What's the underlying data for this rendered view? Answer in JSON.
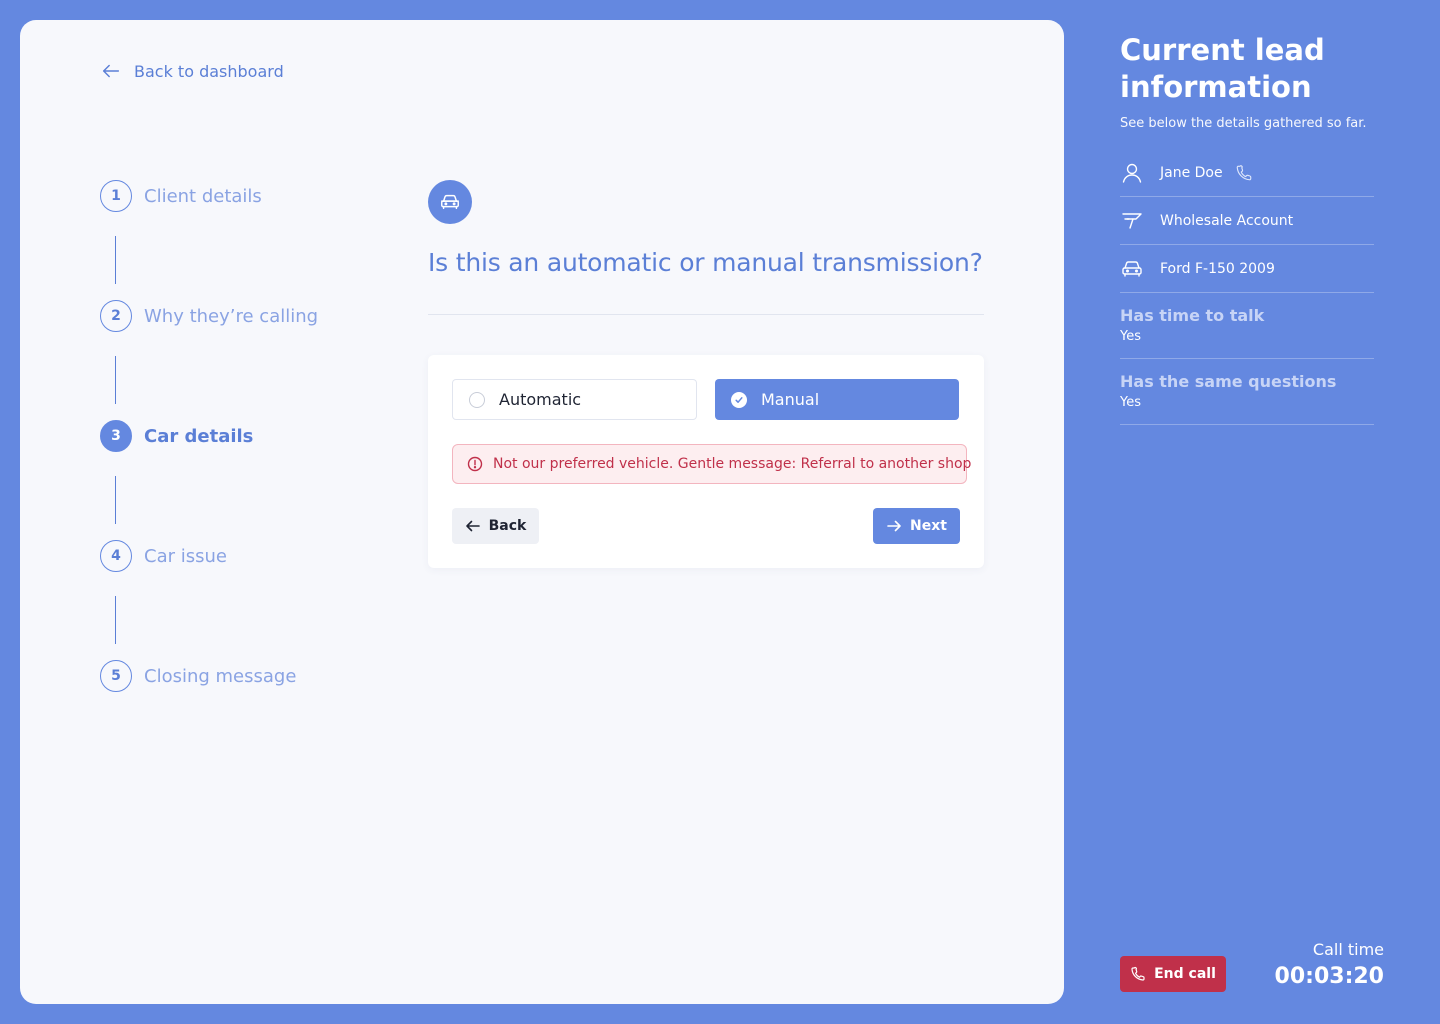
{
  "nav": {
    "back_label": "Back to dashboard"
  },
  "steps": [
    {
      "number": "1",
      "label": "Client details",
      "active": false
    },
    {
      "number": "2",
      "label": "Why they’re calling",
      "active": false
    },
    {
      "number": "3",
      "label": "Car details",
      "active": true
    },
    {
      "number": "4",
      "label": "Car issue",
      "active": false
    },
    {
      "number": "5",
      "label": "Closing message",
      "active": false
    }
  ],
  "question": {
    "icon": "car-icon",
    "text": "Is this an automatic or manual transmission?",
    "options": [
      {
        "label": "Automatic",
        "selected": false
      },
      {
        "label": "Manual",
        "selected": true
      }
    ],
    "alert": "Not our preferred vehicle. Gentle message: Referral to another shop",
    "back_label": "Back",
    "next_label": "Next"
  },
  "sidebar": {
    "title": "Current lead information",
    "subtitle": "See below the details gathered so far.",
    "contact_name": "Jane Doe",
    "account": "Wholesale Account",
    "vehicle": "Ford F-150 2009",
    "answers": [
      {
        "question": "Has time to talk",
        "answer": "Yes"
      },
      {
        "question": "Has the same questions",
        "answer": "Yes"
      }
    ]
  },
  "call": {
    "end_label": "End call",
    "time_label": "Call time",
    "time": "00:03:20"
  },
  "colors": {
    "background": "#6488e0",
    "accent": "#5b7fd6",
    "danger": "#c0304a",
    "card": "#f7f8fc"
  }
}
